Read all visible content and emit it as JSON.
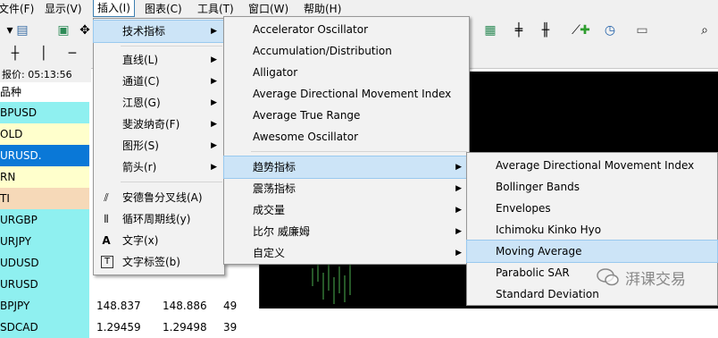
{
  "menubar": {
    "items": [
      "文件(F)",
      "显示(V)",
      "插入(I)",
      "图表(C)",
      "工具(T)",
      "窗口(W)",
      "帮助(H)"
    ]
  },
  "market_watch": {
    "time_label": "报价: 05:13:56",
    "col_symbol": "品种",
    "rows": [
      {
        "symbol": "BPUSD",
        "bid": "",
        "ask": "",
        "spread": "",
        "bg": "#8ff0f0"
      },
      {
        "symbol": "OLD",
        "bid": "",
        "ask": "",
        "spread": "",
        "bg": "#ffffcc"
      },
      {
        "symbol": "URUSD.",
        "bid": "",
        "ask": "",
        "spread": "",
        "bg": "#0a78d7"
      },
      {
        "symbol": "RN",
        "bid": "",
        "ask": "",
        "spread": "",
        "bg": "#ffffcc"
      },
      {
        "symbol": "TI",
        "bid": "",
        "ask": "",
        "spread": "",
        "bg": "#f6d9b8"
      },
      {
        "symbol": "URGBP",
        "bid": "",
        "ask": "",
        "spread": "",
        "bg": "#8ff0f0"
      },
      {
        "symbol": "URJPY",
        "bid": "",
        "ask": "",
        "spread": "",
        "bg": "#8ff0f0"
      },
      {
        "symbol": "UDUSD",
        "bid": "",
        "ask": "",
        "spread": "",
        "bg": "#8ff0f0"
      },
      {
        "symbol": "URUSD",
        "bid": "",
        "ask": "",
        "spread": "",
        "bg": "#8ff0f0"
      },
      {
        "symbol": "BPJPY",
        "bid": "148.837",
        "ask": "148.886",
        "spread": "49",
        "bg": "#8ff0f0"
      },
      {
        "symbol": "SDCAD",
        "bid": "1.29459",
        "ask": "1.29498",
        "spread": "39",
        "bg": "#8ff0f0"
      }
    ]
  },
  "insert_menu": {
    "items": [
      {
        "label": "技术指标",
        "has_submenu": true,
        "highlighted": true
      },
      {
        "label": "直线(L)",
        "has_submenu": true
      },
      {
        "label": "通道(C)",
        "has_submenu": true
      },
      {
        "label": "江恩(G)",
        "has_submenu": true
      },
      {
        "label": "斐波纳奇(F)",
        "has_submenu": true
      },
      {
        "label": "图形(S)",
        "has_submenu": true
      },
      {
        "label": "箭头(r)",
        "has_submenu": true
      },
      {
        "label": "安德鲁分叉线(A)",
        "icon": "andrews-pitchfork-icon"
      },
      {
        "label": "循环周期线(y)",
        "icon": "cycle-lines-icon"
      },
      {
        "label": "文字(x)",
        "icon": "text-icon"
      },
      {
        "label": "文字标签(b)",
        "icon": "text-label-icon"
      }
    ]
  },
  "indicators_menu": {
    "items": [
      {
        "label": "Accelerator Oscillator"
      },
      {
        "label": "Accumulation/Distribution"
      },
      {
        "label": "Alligator"
      },
      {
        "label": "Average Directional Movement Index"
      },
      {
        "label": "Average True Range"
      },
      {
        "label": "Awesome Oscillator"
      },
      {
        "label": "趋势指标",
        "has_submenu": true,
        "highlighted": true
      },
      {
        "label": "震荡指标",
        "has_submenu": true
      },
      {
        "label": "成交量",
        "has_submenu": true
      },
      {
        "label": "比尔 威廉姆",
        "has_submenu": true
      },
      {
        "label": "自定义",
        "has_submenu": true
      }
    ]
  },
  "trend_menu": {
    "items": [
      {
        "label": "Average Directional Movement Index"
      },
      {
        "label": "Bollinger Bands"
      },
      {
        "label": "Envelopes"
      },
      {
        "label": "Ichimoku Kinko Hyo"
      },
      {
        "label": "Moving Average",
        "highlighted": true
      },
      {
        "label": "Parabolic SAR"
      },
      {
        "label": "Standard Deviation"
      }
    ]
  },
  "watermark": {
    "text": "湃课交易"
  },
  "colors": {
    "menu_highlight": "#cce4f7",
    "chart_bg": "#000000"
  }
}
